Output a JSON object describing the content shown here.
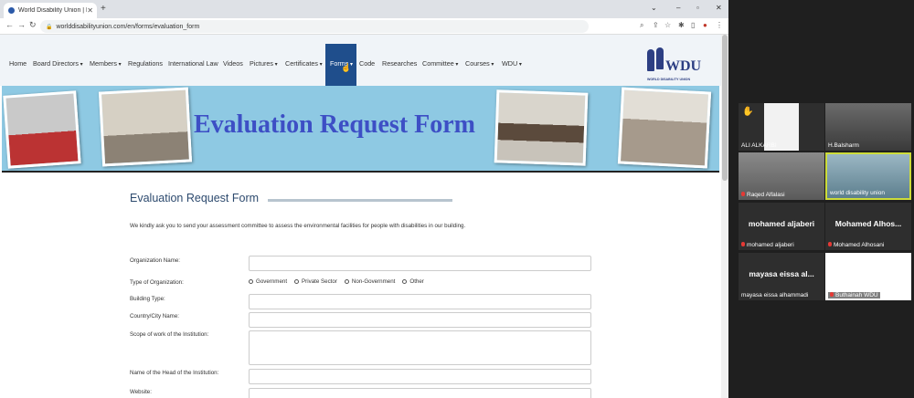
{
  "browser": {
    "tab_title": "World Disability Union | Evaluati",
    "url": "worlddisabilityunion.com/en/forms/evaluation_form"
  },
  "nav": {
    "items": [
      {
        "label": "Home",
        "dd": false
      },
      {
        "label": "Board Directors",
        "dd": true
      },
      {
        "label": "Members",
        "dd": true
      },
      {
        "label": "Regulations",
        "dd": false
      },
      {
        "label": "International Law",
        "dd": false
      },
      {
        "label": "Videos",
        "dd": false
      },
      {
        "label": "Pictures",
        "dd": true
      },
      {
        "label": "Certificates",
        "dd": true
      },
      {
        "label": "Forms",
        "dd": true
      },
      {
        "label": "Code",
        "dd": false
      },
      {
        "label": "Researches",
        "dd": false
      },
      {
        "label": "Committee",
        "dd": true
      },
      {
        "label": "Courses",
        "dd": true
      },
      {
        "label": "WDU",
        "dd": true
      }
    ],
    "logo_text": "WDU",
    "logo_sub": "WORLD DISABILITY UNION"
  },
  "banner": {
    "title": "Evaluation Request Form"
  },
  "form": {
    "title": "Evaluation Request Form",
    "intro": "We kindly ask you to send your assessment committee to assess the environmental facilities for people with disabilities in our building.",
    "labels": {
      "org_name": "Organization Name:",
      "org_type": "Type of Organization:",
      "building_type": "Building Type:",
      "country_city": "Country/City Name:",
      "scope": "Scope of work of the Institution:",
      "head_name": "Name of the Head of the Institution:",
      "website": "Website:"
    },
    "org_type_options": [
      "Government",
      "Private Sector",
      "Non-Government",
      "Other"
    ]
  },
  "meeting": {
    "participants": [
      {
        "name": "ALI ALKARBI",
        "display": "",
        "muted": false
      },
      {
        "name": "H.Balsharm",
        "display": "",
        "muted": false
      },
      {
        "name": "Raqed Alfalasi",
        "display": "",
        "muted": true
      },
      {
        "name": "world disability union",
        "display": "",
        "muted": false
      },
      {
        "name": "mohamed aljaberi",
        "display": "mohamed aljaberi",
        "muted": true
      },
      {
        "name": "Mohamed Alhosani",
        "display": "Mohamed  Alhos...",
        "muted": true
      },
      {
        "name": "mayasa eissa alhammadi",
        "display": "mayasa eissa al...",
        "muted": false
      },
      {
        "name": "Buthainah WDU",
        "display": "",
        "muted": true
      }
    ]
  },
  "colors": {
    "accent": "#1f4e8c",
    "banner": "#8ec9e3",
    "title": "#3d4fc5",
    "speaker_border": "#cddc39"
  }
}
